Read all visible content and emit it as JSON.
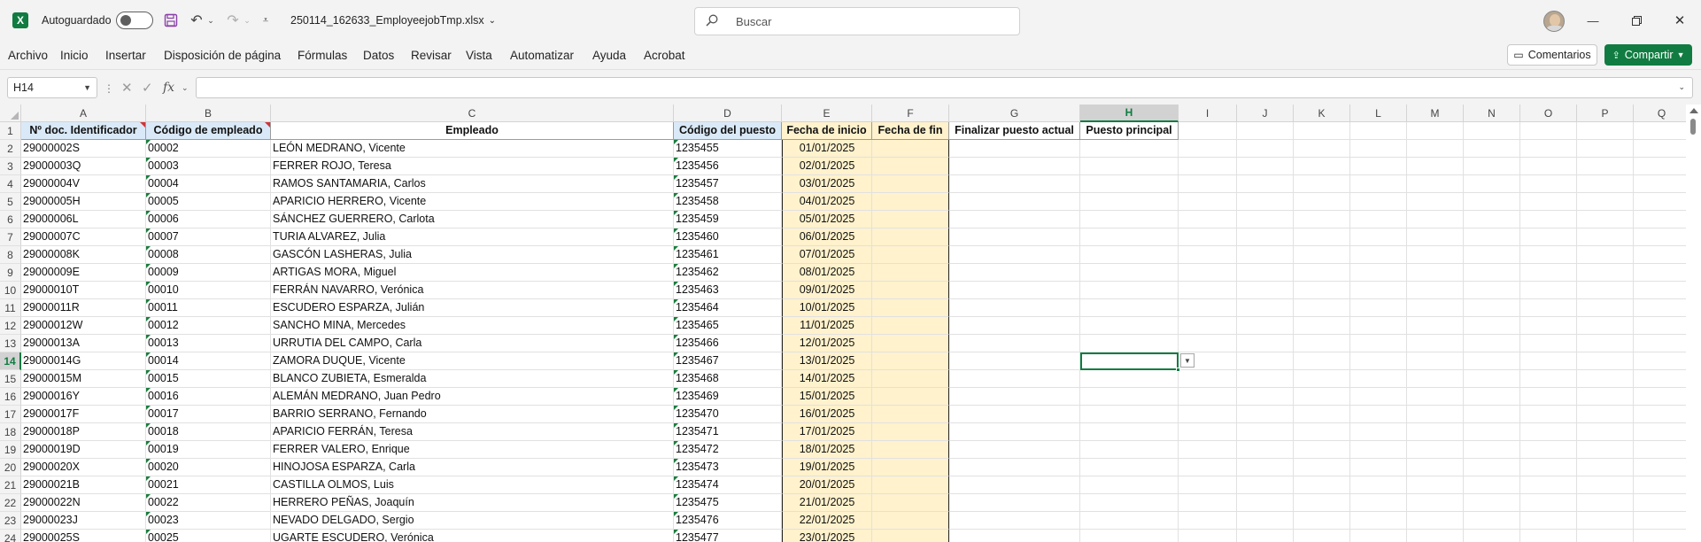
{
  "titlebar": {
    "autosave_label": "Autoguardado",
    "filename": "250114_162633_EmployeejobTmp.xlsx",
    "search_placeholder": "Buscar"
  },
  "menu": {
    "items": [
      "Archivo",
      "Inicio",
      "Insertar",
      "Disposición de página",
      "Fórmulas",
      "Datos",
      "Revisar",
      "Vista",
      "Automatizar",
      "Ayuda",
      "Acrobat"
    ],
    "comments_label": "Comentarios",
    "share_label": "Compartir"
  },
  "formula_bar": {
    "name_box": "H14",
    "formula": ""
  },
  "sheet": {
    "column_letters": [
      "A",
      "B",
      "C",
      "D",
      "E",
      "F",
      "G",
      "H",
      "I",
      "J",
      "K",
      "L",
      "M",
      "N",
      "O",
      "P",
      "Q"
    ],
    "active_column": "H",
    "active_row": 14,
    "headers": [
      "Nº doc. Identificador",
      "Código de empleado",
      "Empleado",
      "Código del puesto",
      "Fecha de inicio",
      "Fecha de fin",
      "Finalizar puesto actual",
      "Puesto principal"
    ],
    "rows": [
      [
        "29000002S",
        "00002",
        "LEÓN MEDRANO, Vicente",
        "1235455",
        "01/01/2025"
      ],
      [
        "29000003Q",
        "00003",
        "FERRER ROJO, Teresa",
        "1235456",
        "02/01/2025"
      ],
      [
        "29000004V",
        "00004",
        "RAMOS SANTAMARIA, Carlos",
        "1235457",
        "03/01/2025"
      ],
      [
        "29000005H",
        "00005",
        "APARICIO HERRERO, Vicente",
        "1235458",
        "04/01/2025"
      ],
      [
        "29000006L",
        "00006",
        "SÁNCHEZ GUERRERO, Carlota",
        "1235459",
        "05/01/2025"
      ],
      [
        "29000007C",
        "00007",
        "TURIA ALVAREZ, Julia",
        "1235460",
        "06/01/2025"
      ],
      [
        "29000008K",
        "00008",
        "GASCÓN LASHERAS, Julia",
        "1235461",
        "07/01/2025"
      ],
      [
        "29000009E",
        "00009",
        "ARTIGAS MORA, Miguel",
        "1235462",
        "08/01/2025"
      ],
      [
        "29000010T",
        "00010",
        "FERRÁN NAVARRO, Verónica",
        "1235463",
        "09/01/2025"
      ],
      [
        "29000011R",
        "00011",
        "ESCUDERO ESPARZA, Julián",
        "1235464",
        "10/01/2025"
      ],
      [
        "29000012W",
        "00012",
        "SANCHO MINA, Mercedes",
        "1235465",
        "11/01/2025"
      ],
      [
        "29000013A",
        "00013",
        "URRUTIA DEL CAMPO, Carla",
        "1235466",
        "12/01/2025"
      ],
      [
        "29000014G",
        "00014",
        "ZAMORA DUQUE, Vicente",
        "1235467",
        "13/01/2025"
      ],
      [
        "29000015M",
        "00015",
        "BLANCO ZUBIETA, Esmeralda",
        "1235468",
        "14/01/2025"
      ],
      [
        "29000016Y",
        "00016",
        "ALEMÁN MEDRANO, Juan Pedro",
        "1235469",
        "15/01/2025"
      ],
      [
        "29000017F",
        "00017",
        "BARRIO SERRANO, Fernando",
        "1235470",
        "16/01/2025"
      ],
      [
        "29000018P",
        "00018",
        "APARICIO FERRÁN, Teresa",
        "1235471",
        "17/01/2025"
      ],
      [
        "29000019D",
        "00019",
        "FERRER VALERO, Enrique",
        "1235472",
        "18/01/2025"
      ],
      [
        "29000020X",
        "00020",
        "HINOJOSA ESPARZA, Carla",
        "1235473",
        "19/01/2025"
      ],
      [
        "29000021B",
        "00021",
        "CASTILLA OLMOS, Luis",
        "1235474",
        "20/01/2025"
      ],
      [
        "29000022N",
        "00022",
        "HERRERO PEÑAS, Joaquín",
        "1235475",
        "21/01/2025"
      ],
      [
        "29000023J",
        "00023",
        "NEVADO DELGADO, Sergio",
        "1235476",
        "22/01/2025"
      ],
      [
        "29000025S",
        "00025",
        "UGARTE ESCUDERO, Verónica",
        "1235477",
        "23/01/2025"
      ]
    ]
  },
  "colors": {
    "accent": "#107c41",
    "header_blue": "#dae9f8",
    "header_yellow": "#fff2cc"
  }
}
